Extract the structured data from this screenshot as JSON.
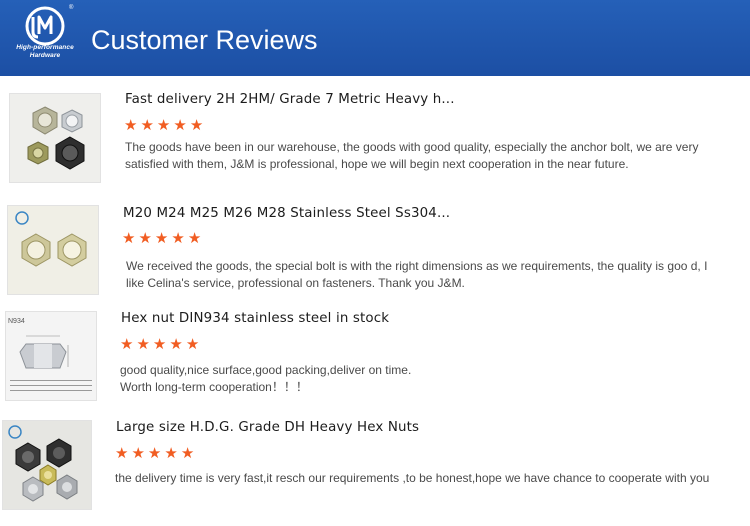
{
  "header": {
    "title": "Customer Reviews",
    "logo": {
      "mark": "JM",
      "tagline_1": "High-performance",
      "tagline_2": "Hardware",
      "reg": "®"
    }
  },
  "colors": {
    "header_bg": "#1f55aa",
    "star": "#f15d22",
    "text": "#4a4a4a"
  },
  "rating_icon": "star-icon",
  "reviews": [
    {
      "title": "Fast delivery 2H 2HM/ Grade 7 Metric Heavy h...",
      "rating": 5,
      "text": "The goods have been in our warehouse, the goods with good quality, especially the anchor bolt, we are very satisfied with them, J&M is professional, hope we will begin next cooperation in the near future.",
      "image": "hex-nuts-assorted-photo"
    },
    {
      "title": "M20 M24 M25 M26 M28 Stainless Steel Ss304...",
      "rating": 5,
      "text": "We received the goods, the special bolt is with the right dimensions as we requirements, the quality is goo d, I like Celina's service, professional on fasteners. Thank you J&M.",
      "image": "heavy-hex-nuts-photo"
    },
    {
      "title": "Hex nut DIN934 stainless steel in stock",
      "rating": 5,
      "text_lines": [
        "good quality,nice surface,good packing,deliver on time.",
        "Worth long-term cooperation！！！"
      ],
      "image": "din934-drawing",
      "image_label": "N934"
    },
    {
      "title": "Large size H.D.G. Grade DH Heavy Hex Nuts",
      "rating": 5,
      "text": "the delivery time is very fast,it resch our requirements ,to be honest,hope we have chance to cooperate with you",
      "image": "hdg-hex-nuts-photo"
    }
  ]
}
